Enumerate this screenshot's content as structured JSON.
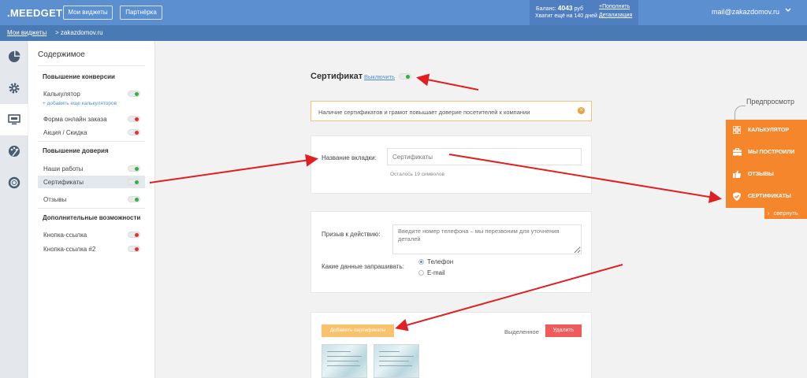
{
  "topbar": {
    "logo": ".MEEDGET",
    "my_widgets_btn": "Мои виджеты",
    "partnership_btn": "Партнёрка",
    "balance_label": "Баланс:",
    "balance_value": "4043",
    "balance_currency": "руб",
    "balance_days": "Хватит ещё на 140 дней",
    "topup": "+Пополнить",
    "details": "Детализация",
    "user_email": "mail@zakazdomov.ru",
    "dropdown_icon": "chevron-down-icon"
  },
  "breadcrumb": {
    "root": "Мои виджеты",
    "current": "> zakazdomov.ru"
  },
  "rail": {
    "items": [
      "pie-chart-icon",
      "gear-icon",
      "monitor-icon",
      "palette-icon",
      "lifebuoy-icon"
    ]
  },
  "sidebar": {
    "title": "Содержимое",
    "sections": [
      {
        "title": "Повышение конверсии",
        "items": [
          {
            "label": "Калькулятор",
            "enabled": true
          },
          {
            "label": "Форма онлайн заказа",
            "enabled": false
          },
          {
            "label": "Акция / Скидка",
            "enabled": false
          }
        ],
        "add_link": "+ добавить еще калькуляторов"
      },
      {
        "title": "Повышение доверия",
        "items": [
          {
            "label": "Наши работы",
            "enabled": true
          },
          {
            "label": "Сертификаты",
            "enabled": true
          },
          {
            "label": "Отзывы",
            "enabled": true
          }
        ]
      },
      {
        "title": "Дополнительные возможности",
        "items": [
          {
            "label": "Кнопка-ссылка",
            "enabled": false
          },
          {
            "label": "Кнопка-ссылка #2",
            "enabled": false
          }
        ]
      }
    ]
  },
  "main": {
    "title": "Сертификат",
    "disable_link": "Выключить",
    "notice": "Наличие сертификатов и грамот повышает доверие посетителей к компании",
    "tab_name_label": "Название вкладки:",
    "tab_name_value": "Сертификаты",
    "chars_left": "Осталось 19 символов",
    "cta_label": "Призыв к действию:",
    "cta_placeholder": "Введите номер телефона – мы перезвоним для уточнения деталей",
    "ask_label": "Какие данные запрашивать:",
    "ask_options": [
      "Телефон",
      "E-mail"
    ],
    "ask_selected": "Телефон",
    "add_button": "Добавить сертификаты",
    "selected_label": "Выделенное",
    "delete_button": "Удалить"
  },
  "preview": {
    "label": "Предпросмотр",
    "items": [
      {
        "label": "КАЛЬКУЛЯТОР",
        "icon": "calculator-icon"
      },
      {
        "label": "МЫ ПОСТРОИЛИ",
        "icon": "briefcase-icon"
      },
      {
        "label": "ОТЗЫВЫ",
        "icon": "thumbs-up-icon"
      },
      {
        "label": "СЕРТИФИКАТЫ",
        "icon": "shield-check-icon"
      }
    ],
    "collapse": "свернуть"
  },
  "colors": {
    "topbar": "#5b8fd0",
    "crumbbar": "#4a7ab4",
    "accent_orange": "#f5862c",
    "toggle_on": "#2fb344",
    "toggle_off": "#e03232",
    "arrow_red": "#e02020",
    "delete_red": "#f05a5a"
  }
}
